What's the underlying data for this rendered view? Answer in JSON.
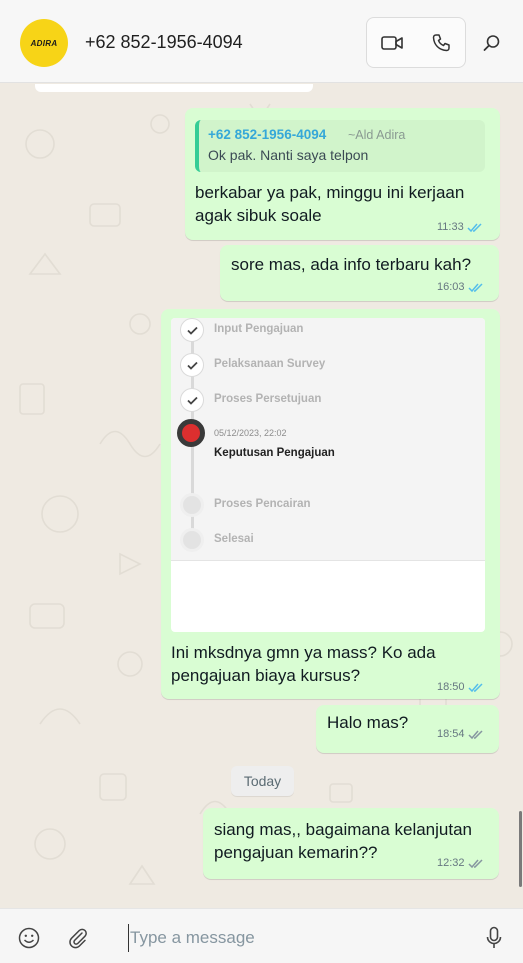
{
  "header": {
    "avatar_text": "ADIRA",
    "contact_name": "+62 852-1956-4094",
    "video_icon": "video-camera-icon",
    "call_icon": "phone-icon",
    "search_icon": "search-icon"
  },
  "messages": [
    {
      "quote": {
        "sender": "+62 852-1956-4094",
        "alias": "~Ald Adira",
        "text": "Ok pak. Nanti saya telpon"
      },
      "lines": [
        "berkabar ya pak, minggu ini kerjaan",
        "agak sibuk soale"
      ],
      "time": "11:33",
      "status": "read"
    },
    {
      "lines": [
        "sore mas, ada info terbaru kah?"
      ],
      "time": "16:03",
      "status": "read"
    },
    {
      "image_steps": [
        {
          "label": "Input Pengajuan",
          "state": "done"
        },
        {
          "label": "Pelaksanaan Survey",
          "state": "done"
        },
        {
          "label": "Proses Persetujuan",
          "state": "done"
        },
        {
          "date": "05/12/2023, 22:02",
          "label": "Keputusan Pengajuan",
          "state": "active"
        },
        {
          "label": "Proses Pencairan",
          "state": "pending"
        },
        {
          "label": "Selesai",
          "state": "pending"
        }
      ],
      "lines": [
        "Ini mksdnya gmn ya mass? Ko ada",
        "pengajuan biaya kursus?"
      ],
      "time": "18:50",
      "status": "read"
    },
    {
      "lines": [
        "Halo mas?"
      ],
      "time": "18:54",
      "status": "delivered"
    },
    {
      "lines": [
        "siang mas,, bagaimana kelanjutan",
        "pengajuan kemarin??"
      ],
      "time": "12:32",
      "status": "delivered"
    }
  ],
  "day_separator": "Today",
  "footer": {
    "emoji_icon": "emoji-icon",
    "attach_icon": "paperclip-icon",
    "input_placeholder": "Type a message",
    "mic_icon": "microphone-icon"
  },
  "colors": {
    "outgoing_bubble": "#d9fdd3",
    "read_ticks": "#53bdeb",
    "delivered_ticks": "#8696a0",
    "chat_background": "#efeae2",
    "brand_yellow": "#f7d417"
  }
}
